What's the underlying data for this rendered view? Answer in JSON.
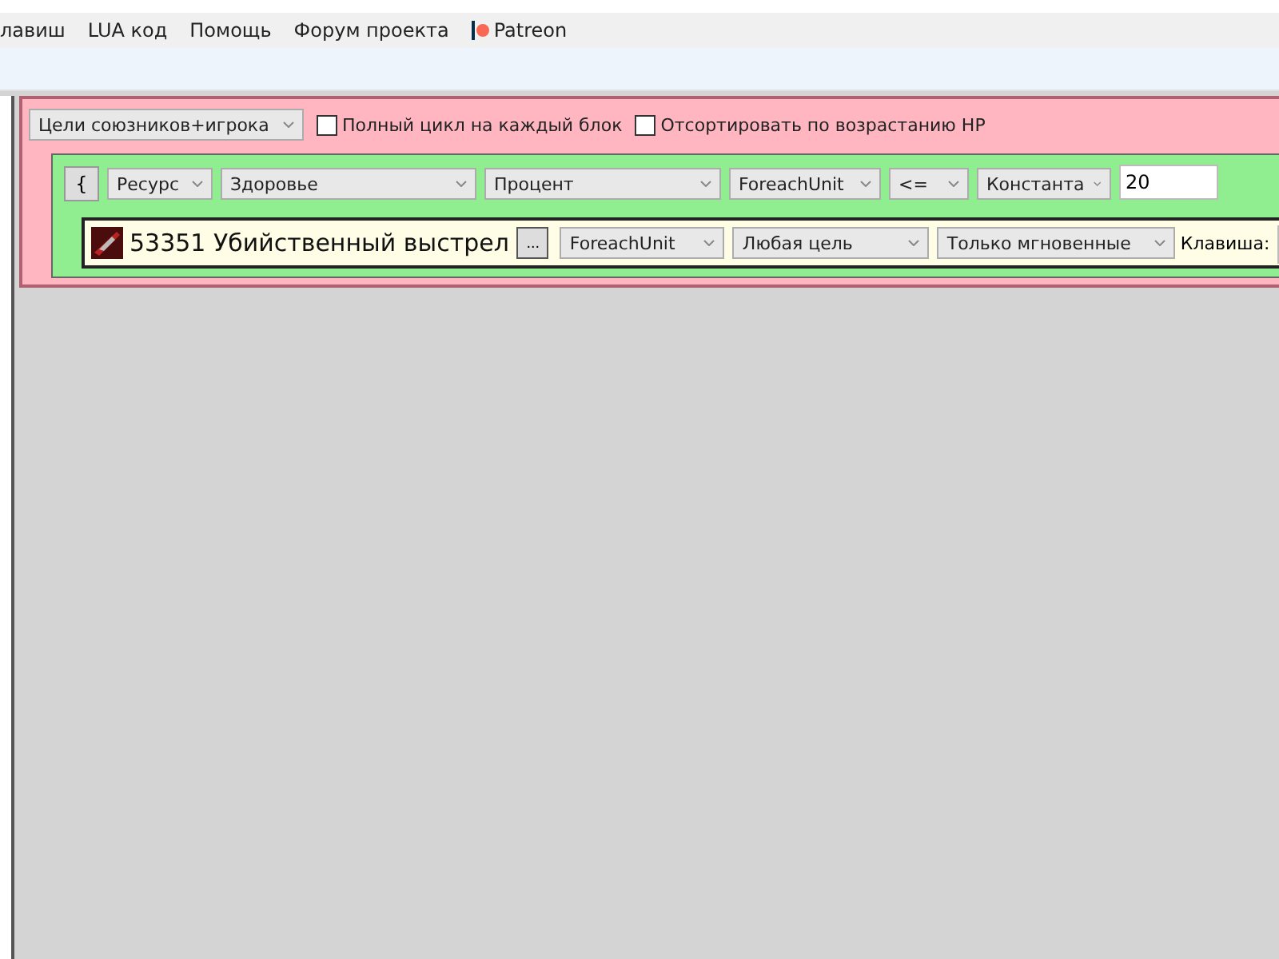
{
  "menu": [
    {
      "label": "лавиш"
    },
    {
      "label": "LUA код"
    },
    {
      "label": "Помощь"
    },
    {
      "label": "Форум проекта"
    },
    {
      "label": "Patreon",
      "kind": "patreon"
    }
  ],
  "block": {
    "target": "Цели союзников+игрока",
    "options": [
      {
        "label": "Полный цикл на каждый блок",
        "checked": false
      },
      {
        "label": "Отсортировать по возрастанию HP",
        "checked": false
      }
    ],
    "condition": [
      {
        "kind": "button",
        "text": "{"
      },
      {
        "kind": "dropdown",
        "text": "Ресурс"
      },
      {
        "kind": "dropdown",
        "text": "Здоровье"
      },
      {
        "kind": "dropdown",
        "text": "Процент"
      },
      {
        "kind": "dropdown",
        "text": "ForeachUnit"
      },
      {
        "kind": "dropdown",
        "text": "<="
      },
      {
        "kind": "dropdown",
        "text": "Константа"
      },
      {
        "kind": "input",
        "text": "20"
      }
    ],
    "action": {
      "spell": "53351 Убийственный выстрел",
      "more": "...",
      "controls": [
        {
          "kind": "dropdown",
          "text": "ForeachUnit"
        },
        {
          "kind": "dropdown",
          "text": "Любая цель"
        },
        {
          "kind": "dropdown",
          "text": "Только мгновенные"
        },
        {
          "kind": "label",
          "text": "Клавиша:"
        },
        {
          "kind": "input"
        }
      ]
    }
  }
}
